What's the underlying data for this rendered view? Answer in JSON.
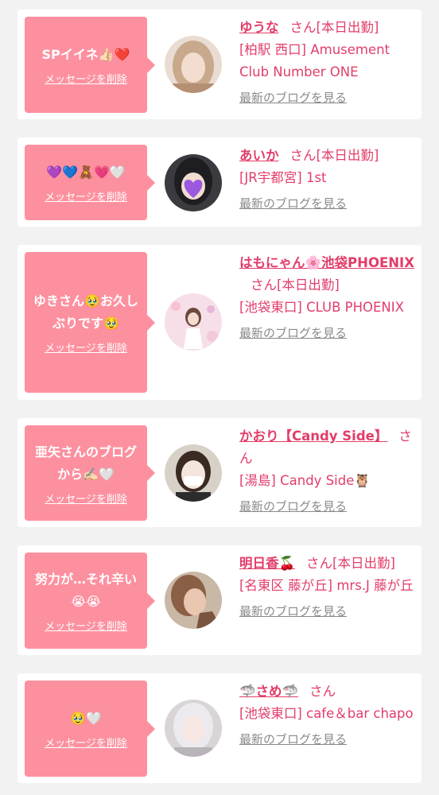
{
  "cards": [
    {
      "message": "SPイイネ👍🏻❤️",
      "delete_label": "メッセージを削除",
      "name": "ゆうな",
      "suffix": "さん[本日出勤]",
      "shop": "[柏駅 西口] Amusement Club Number ONE",
      "blog_label": "最新のブログを見る"
    },
    {
      "message": "💜💙🧸💗🤍",
      "delete_label": "メッセージを削除",
      "name": "あいか",
      "suffix": "さん[本日出勤]",
      "shop": "[JR宇都宮] 1st",
      "blog_label": "最新のブログを見る"
    },
    {
      "message": "ゆきさん🥹お久しぶりです🥹",
      "delete_label": "メッセージを削除",
      "name": "はもにゃん🌸池袋PHOENIX",
      "suffix": "さん[本日出勤]",
      "shop": "[池袋東口] CLUB PHOENIX",
      "blog_label": "最新のブログを見る"
    },
    {
      "message": "亜矢さんのブログから✍🏻🤍",
      "delete_label": "メッセージを削除",
      "name": "かおり【Candy Side】",
      "suffix": "さん",
      "shop": "[湯島] Candy Side🦉",
      "blog_label": "最新のブログを見る"
    },
    {
      "message": "努力が…それ辛い😭😭",
      "delete_label": "メッセージを削除",
      "name": "明日香🍒",
      "suffix": "さん[本日出勤]",
      "shop": "[名東区 藤が丘] mrs.J 藤が丘",
      "blog_label": "最新のブログを見る"
    },
    {
      "message": "🥹🤍",
      "delete_label": "メッセージを削除",
      "name": "🦈さめ🦈",
      "suffix": "さん",
      "shop": "[池袋東口] cafe＆bar chapo",
      "blog_label": "最新のブログを見る"
    }
  ],
  "colors": {
    "accent": "#e23d69",
    "bubble": "#fd909f",
    "muted": "#8a8a8a",
    "background": "#f2f2f2"
  }
}
